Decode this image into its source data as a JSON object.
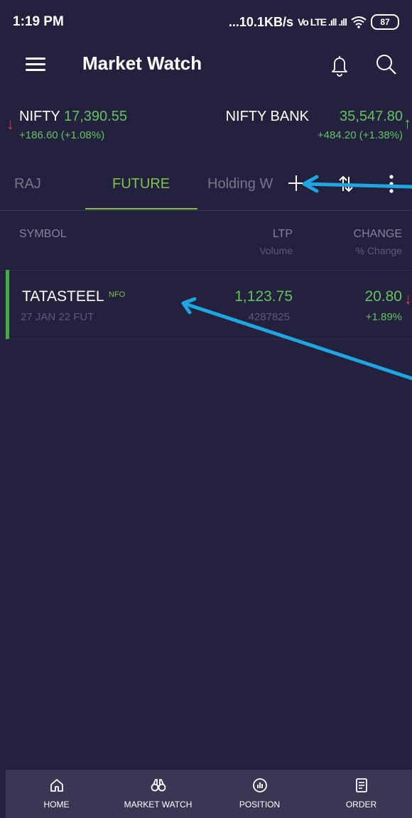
{
  "status_bar": {
    "time": "1:19 PM",
    "network": "...10.1KB/s",
    "signal": "Vo LTE .ıll .ıll",
    "battery": "87"
  },
  "header": {
    "title": "Market Watch",
    "icons": [
      "menu-icon",
      "bell-icon",
      "search-icon"
    ]
  },
  "indices": {
    "nifty": {
      "name": "NIFTY",
      "value": "17,390.55",
      "change": "+186.60  (+1.08%)",
      "arrow": "↓"
    },
    "bank": {
      "name": "NIFTY BANK",
      "value": "35,547.80",
      "change": "+484.20  (+1.38%)",
      "arrow": "↑"
    }
  },
  "tabs": [
    {
      "label": "RAJ"
    },
    {
      "label": "FUTURE"
    },
    {
      "label": "Holding W"
    }
  ],
  "active_tab": "FUTURE",
  "columns": {
    "symbol": "SYMBOL",
    "ltp": "LTP",
    "volume": "Volume",
    "change": "CHANGE",
    "pct_change": "% Change"
  },
  "rows": [
    {
      "symbol": "TATASTEEL",
      "exchange": "NFO",
      "expiry": "27 JAN 22 FUT",
      "ltp": "1,123.75",
      "volume": "4287825",
      "change": "20.80",
      "pct_change": "+1.89%",
      "arrow": "↓"
    }
  ],
  "bottom_nav": [
    {
      "label": "HOME",
      "icon": "home-icon"
    },
    {
      "label": "MARKET WATCH",
      "icon": "binoculars-icon"
    },
    {
      "label": "POSITION",
      "icon": "position-icon"
    },
    {
      "label": "ORDER",
      "icon": "order-icon"
    }
  ],
  "colors": {
    "background": "#24213e",
    "positive": "#63c45e",
    "negative": "#e23b3b",
    "accent": "#7fc34d",
    "annotation": "#1fa5e0"
  }
}
